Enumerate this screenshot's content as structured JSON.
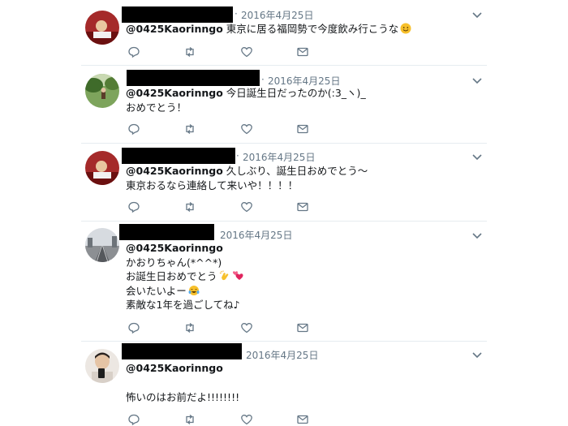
{
  "tweets": [
    {
      "separator": "·",
      "date": "2016年4月25日",
      "mention": "@0425Kaorinngo",
      "body_inline": " 東京に居る福岡勢で今度飲み行こうな",
      "lines": [],
      "emoji": [
        "smiling-face-icon"
      ]
    },
    {
      "separator": "·",
      "date": "2016年4月25日",
      "mention": "@0425Kaorinngo",
      "body_inline": " 今日誕生日だったのか(:3_ヽ)_",
      "lines": [
        "おめでとう！"
      ],
      "emoji": []
    },
    {
      "separator": "·",
      "date": "2016年4月25日",
      "mention": "@0425Kaorinngo",
      "body_inline": " 久しぶり、誕生日おめでとう〜",
      "lines": [
        "東京おるなら連絡して来いや！！！！"
      ],
      "emoji": []
    },
    {
      "separator": "·",
      "date": "2016年4月25日",
      "mention": "@0425Kaorinngo",
      "body_inline": "",
      "lines": [
        "かおりちゃん(*^^*)",
        "お誕生日おめでとう",
        "会いたいよー",
        "素敵な1年を過ごしてね♪"
      ],
      "emoji": [
        "clapping-hands-icon",
        "two-hearts-icon",
        "tears-of-joy-icon"
      ]
    },
    {
      "separator": "",
      "date": "2016年4月25日",
      "mention": "@0425Kaorinngo",
      "body_inline": "",
      "lines": [
        "怖いのはお前だよ!!!!!!!!"
      ],
      "emoji": []
    }
  ],
  "actions": [
    "reply-icon",
    "retweet-icon",
    "like-icon",
    "direct-message-icon"
  ],
  "colors": {
    "text": "#14171a",
    "muted": "#657786",
    "divider": "#e6ecf0",
    "redaction": "#000000"
  }
}
